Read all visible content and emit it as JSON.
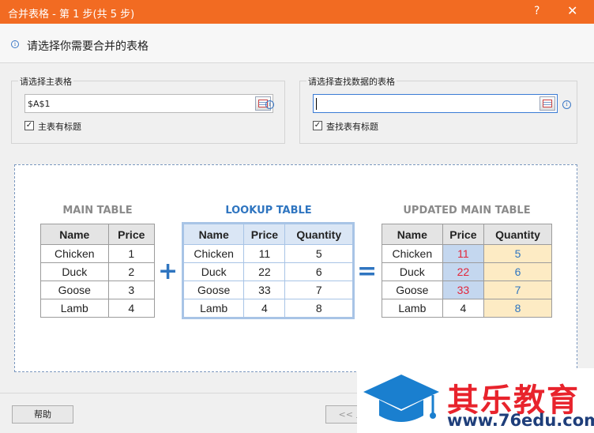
{
  "window": {
    "title": "合并表格 - 第 1 步(共 5 步)",
    "help": "?",
    "close": "✕"
  },
  "header": {
    "instruction": "请选择你需要合并的表格",
    "info_icon": "info-icon"
  },
  "main_table": {
    "label": "请选择主表格",
    "value": "$A$1",
    "has_header_label": "主表有标题",
    "has_header": true
  },
  "lookup_table": {
    "label": "请选择查找数据的表格",
    "value": "",
    "has_header_label": "查找表有标题",
    "has_header": true
  },
  "illustration": {
    "main_caption": "MAIN TABLE",
    "lookup_caption": "LOOKUP TABLE",
    "updated_caption": "UPDATED MAIN TABLE",
    "plus": "+",
    "equals": "=",
    "main_headers": [
      "Name",
      "Price"
    ],
    "main_rows": [
      [
        "Chicken",
        "1"
      ],
      [
        "Duck",
        "2"
      ],
      [
        "Goose",
        "3"
      ],
      [
        "Lamb",
        "4"
      ]
    ],
    "lookup_headers": [
      "Name",
      "Price",
      "Quantity"
    ],
    "lookup_rows": [
      [
        "Chicken",
        "11",
        "5"
      ],
      [
        "Duck",
        "22",
        "6"
      ],
      [
        "Goose",
        "33",
        "7"
      ],
      [
        "Lamb",
        "4",
        "8"
      ]
    ],
    "updated_headers": [
      "Name",
      "Price",
      "Quantity"
    ],
    "updated_rows": [
      [
        "Chicken",
        "11",
        "5"
      ],
      [
        "Duck",
        "22",
        "6"
      ],
      [
        "Goose",
        "33",
        "7"
      ],
      [
        "Lamb",
        "4",
        "8"
      ]
    ],
    "colors": {
      "accent": "#2f75c0",
      "updated_price": "#e2263a",
      "updated_price_bg": "#c4d7ef",
      "updated_qty_bg": "#fdebc4"
    }
  },
  "footer": {
    "help_label": "帮助",
    "prev_label": "<< 上"
  },
  "watermark": {
    "brand": "其乐教育",
    "url": "www.76edu.com"
  },
  "theme": {
    "titlebar": "#f26b22"
  }
}
